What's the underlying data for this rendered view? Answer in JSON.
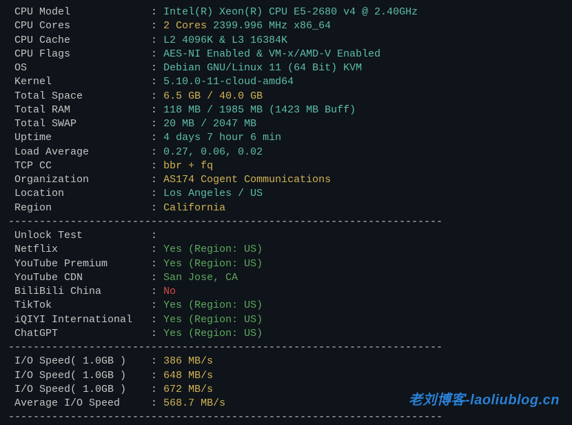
{
  "sysinfo": [
    {
      "label": "CPU Model",
      "parts": [
        {
          "text": "Intel(R) Xeon(R) CPU E5-2680 v4 @ 2.40GHz",
          "cls": "cyan"
        }
      ]
    },
    {
      "label": "CPU Cores",
      "parts": [
        {
          "text": "2 Cores",
          "cls": "yellow"
        },
        {
          "text": " 2399.996 MHz x86_64",
          "cls": "cyan"
        }
      ]
    },
    {
      "label": "CPU Cache",
      "parts": [
        {
          "text": "L2 4096K & L3 16384K",
          "cls": "cyan"
        }
      ]
    },
    {
      "label": "CPU Flags",
      "parts": [
        {
          "text": "AES-NI Enabled & VM-x/AMD-V Enabled",
          "cls": "cyan"
        }
      ]
    },
    {
      "label": "OS",
      "parts": [
        {
          "text": "Debian GNU/Linux 11 (64 Bit) KVM",
          "cls": "cyan"
        }
      ]
    },
    {
      "label": "Kernel",
      "parts": [
        {
          "text": "5.10.0-11-cloud-amd64",
          "cls": "cyan"
        }
      ]
    },
    {
      "label": "Total Space",
      "parts": [
        {
          "text": "6.5 GB / 40.0 GB",
          "cls": "yellow"
        }
      ]
    },
    {
      "label": "Total RAM",
      "parts": [
        {
          "text": "118 MB / 1985 MB (1423 MB Buff)",
          "cls": "cyan"
        }
      ]
    },
    {
      "label": "Total SWAP",
      "parts": [
        {
          "text": "20 MB / 2047 MB",
          "cls": "cyan"
        }
      ]
    },
    {
      "label": "Uptime",
      "parts": [
        {
          "text": "4 days 7 hour 6 min",
          "cls": "cyan"
        }
      ]
    },
    {
      "label": "Load Average",
      "parts": [
        {
          "text": "0.27, 0.06, 0.02",
          "cls": "cyan"
        }
      ]
    },
    {
      "label": "TCP CC",
      "parts": [
        {
          "text": "bbr + fq",
          "cls": "yellow"
        }
      ]
    },
    {
      "label": "Organization",
      "parts": [
        {
          "text": "AS174 Cogent Communications",
          "cls": "yellow"
        }
      ]
    },
    {
      "label": "Location",
      "parts": [
        {
          "text": "Los Angeles / US",
          "cls": "cyan"
        }
      ]
    },
    {
      "label": "Region",
      "parts": [
        {
          "text": "California",
          "cls": "yellow"
        }
      ]
    }
  ],
  "unlock_header": "Unlock Test",
  "unlock": [
    {
      "label": "Netflix",
      "parts": [
        {
          "text": "Yes (Region: US)",
          "cls": "green"
        }
      ]
    },
    {
      "label": "YouTube Premium",
      "parts": [
        {
          "text": "Yes (Region: US)",
          "cls": "green"
        }
      ]
    },
    {
      "label": "YouTube CDN",
      "parts": [
        {
          "text": "San Jose, CA",
          "cls": "green"
        }
      ]
    },
    {
      "label": "BiliBili China",
      "parts": [
        {
          "text": "No",
          "cls": "red"
        }
      ]
    },
    {
      "label": "TikTok",
      "parts": [
        {
          "text": "Yes (Region: US)",
          "cls": "green"
        }
      ]
    },
    {
      "label": "iQIYI International",
      "parts": [
        {
          "text": "Yes (Region: US)",
          "cls": "green"
        }
      ]
    },
    {
      "label": "ChatGPT",
      "parts": [
        {
          "text": "Yes (Region: US)",
          "cls": "green"
        }
      ]
    }
  ],
  "iospeed": [
    {
      "label": "I/O Speed( 1.0GB )",
      "parts": [
        {
          "text": "386 MB/s",
          "cls": "yellow"
        }
      ]
    },
    {
      "label": "I/O Speed( 1.0GB )",
      "parts": [
        {
          "text": "648 MB/s",
          "cls": "yellow"
        }
      ]
    },
    {
      "label": "I/O Speed( 1.0GB )",
      "parts": [
        {
          "text": "672 MB/s",
          "cls": "yellow"
        }
      ]
    },
    {
      "label": "Average I/O Speed",
      "parts": [
        {
          "text": "568.7 MB/s",
          "cls": "yellow"
        }
      ]
    }
  ],
  "divider": "----------------------------------------------------------------------",
  "watermark": "老刘博客-laoliublog.cn"
}
